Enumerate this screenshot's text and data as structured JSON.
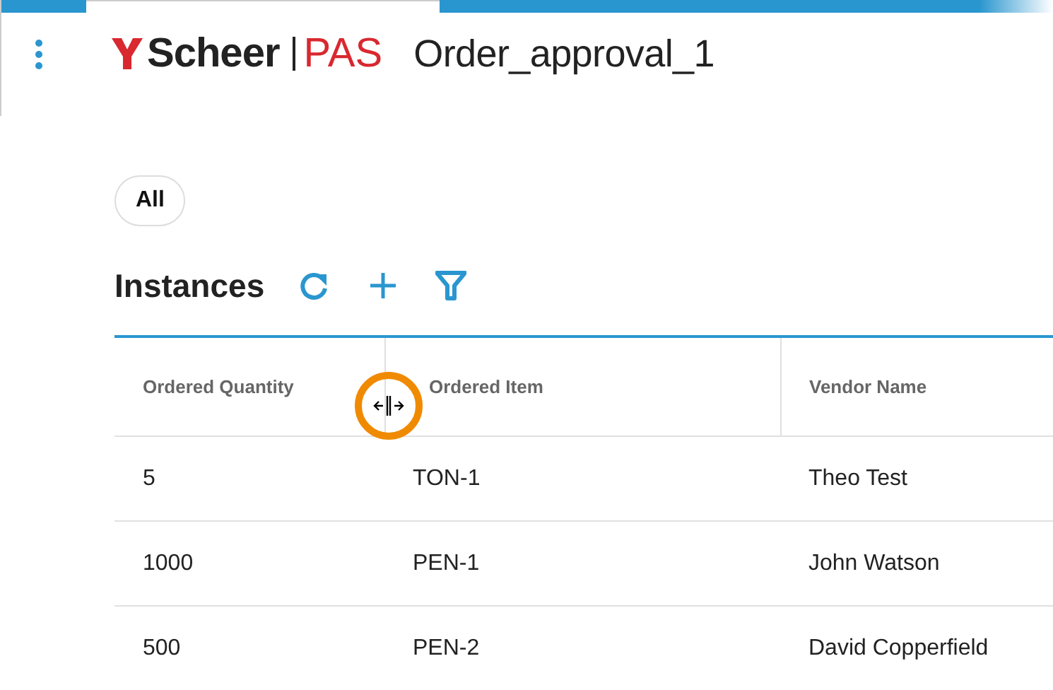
{
  "header": {
    "logo_brand": "Scheer",
    "logo_product": "PAS",
    "title": "Order_approval_1"
  },
  "filters": [
    {
      "label": "All",
      "selected": true
    }
  ],
  "section": {
    "title": "Instances"
  },
  "table": {
    "columns": [
      "Ordered Quantity",
      "Ordered Item",
      "Vendor Name"
    ],
    "rows": [
      [
        "5",
        "TON-1",
        "Theo Test"
      ],
      [
        "1000",
        "PEN-1",
        "John Watson"
      ],
      [
        "500",
        "PEN-2",
        "David Copperfield"
      ]
    ]
  },
  "cursor": {
    "kind": "column-resize"
  }
}
